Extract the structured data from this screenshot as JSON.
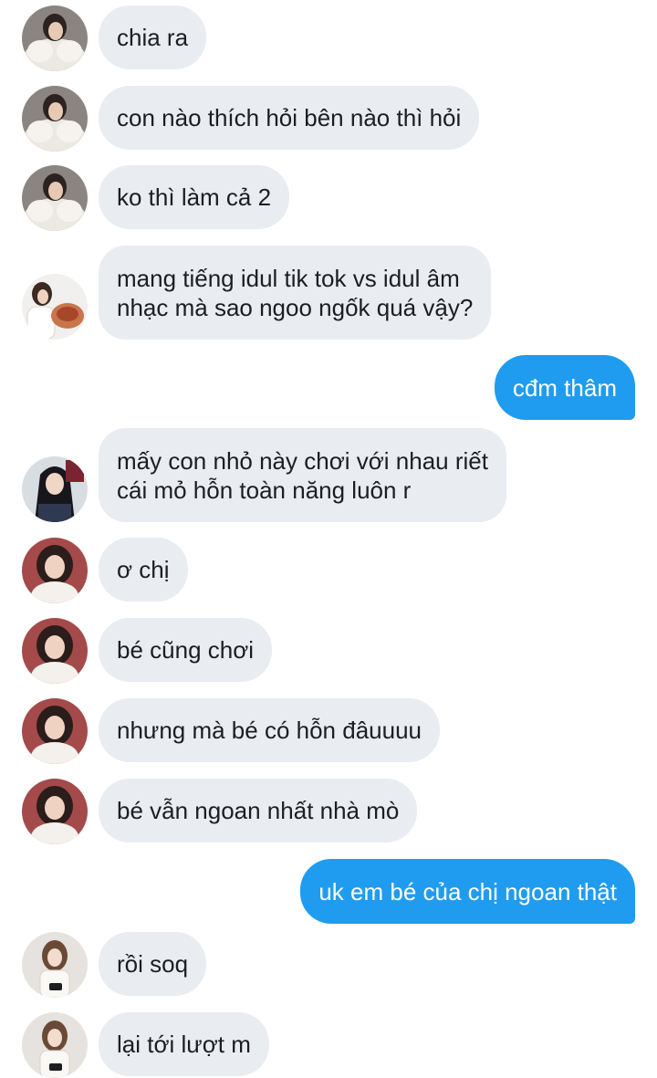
{
  "messages": [
    {
      "side": "in",
      "avatar": "avatar-fur",
      "lines": [
        "chia ra"
      ]
    },
    {
      "side": "in",
      "avatar": "avatar-fur",
      "lines": [
        "con nào thích hỏi bên nào thì hỏi"
      ]
    },
    {
      "side": "in",
      "avatar": "avatar-fur",
      "lines": [
        "ko thì làm cả 2"
      ]
    },
    {
      "side": "in",
      "avatar": "avatar-food",
      "lines": [
        "mang tiếng idul tik tok vs idul âm",
        "nhạc mà sao ngoo ngốk quá vậy?"
      ]
    },
    {
      "side": "out",
      "lines": [
        "cđm thâm"
      ]
    },
    {
      "side": "in",
      "avatar": "avatar-dark",
      "lines": [
        "mấy con nhỏ này chơi với nhau riết",
        "cái mỏ hỗn toàn năng luôn r"
      ]
    },
    {
      "side": "in",
      "avatar": "avatar-red",
      "lines": [
        "ơ chị"
      ]
    },
    {
      "side": "in",
      "avatar": "avatar-red",
      "lines": [
        "bé cũng chơi"
      ]
    },
    {
      "side": "in",
      "avatar": "avatar-red",
      "lines": [
        "nhưng mà bé có hỗn đâuuuu"
      ]
    },
    {
      "side": "in",
      "avatar": "avatar-red",
      "lines": [
        "bé vẫn ngoan nhất nhà mò"
      ]
    },
    {
      "side": "out",
      "lines": [
        "uk em bé của chị ngoan thật"
      ]
    },
    {
      "side": "in",
      "avatar": "avatar-light",
      "lines": [
        "rồi soq"
      ]
    },
    {
      "side": "in",
      "avatar": "avatar-light",
      "lines": [
        "lại tới lượt m"
      ]
    }
  ],
  "colors": {
    "incoming_bubble": "#e9ecf0",
    "outgoing_bubble": "#1f9cf0",
    "incoming_text": "#1c1e21",
    "outgoing_text": "#ffffff"
  }
}
